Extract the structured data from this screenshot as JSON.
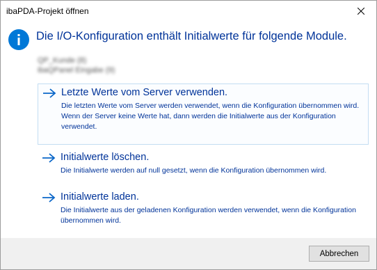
{
  "window": {
    "title": "ibaPDA-Projekt öffnen",
    "close_icon": "close-icon"
  },
  "content": {
    "info_icon": "info-icon",
    "main_instruction": "Die I/O-Konfiguration enthält Initialwerte für folgende Module.",
    "modules": [
      "QP_Kunde (8)",
      "ibaQPanel Eingabe (9)"
    ]
  },
  "options": [
    {
      "title": "Letzte Werte vom Server verwenden.",
      "description": "Die letzten Werte vom Server werden verwendet, wenn die Konfiguration übernommen wird. Wenn der Server keine Werte hat, dann werden die Initialwerte aus der Konfiguration verwendet.",
      "icon": "arrow-right-icon",
      "focused": true
    },
    {
      "title": "Initialwerte löschen.",
      "description": "Die Initialwerte werden auf null gesetzt, wenn die Konfiguration übernommen wird.",
      "icon": "arrow-right-icon",
      "focused": false
    },
    {
      "title": "Initialwerte laden.",
      "description": "Die Initialwerte aus der geladenen Konfiguration werden verwendet, wenn die Konfiguration übernommen wird.",
      "icon": "arrow-right-icon",
      "focused": false
    }
  ],
  "footer": {
    "cancel_label": "Abbrechen"
  },
  "colors": {
    "accent": "#0078d7",
    "link_text": "#003399",
    "focus_border": "#c3ddf2",
    "footer_bg": "#f0f0f0"
  }
}
